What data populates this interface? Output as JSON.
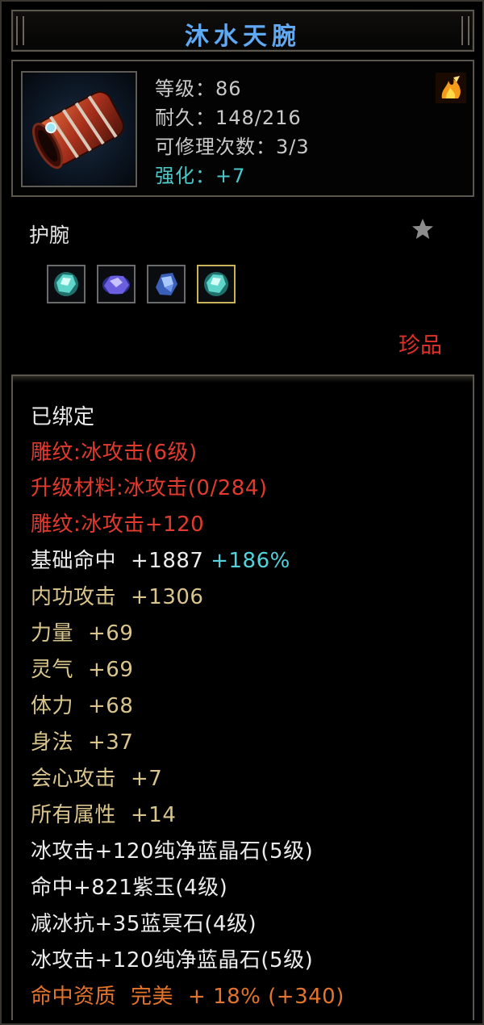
{
  "item": {
    "name": "沐水天腕",
    "level_label": "等级：86",
    "durability_label": "耐久：148/216",
    "repair_label": "可修理次数：3/3",
    "enhance_label": "强化：+7",
    "type": "护腕",
    "rarity": "珍品",
    "icon": "red-bracer-icon"
  },
  "gem_slots": [
    {
      "icon": "teal-gem-icon",
      "selected": false
    },
    {
      "icon": "purple-gem-icon",
      "selected": false
    },
    {
      "icon": "blue-crystal-icon",
      "selected": false
    },
    {
      "icon": "teal-gem-icon",
      "selected": true
    }
  ],
  "properties": {
    "bound": "已绑定",
    "engrave_1": "雕纹:冰攻击(6级)",
    "upgrade_material": "升级材料:冰攻击(0/284)",
    "engrave_2": "雕纹:冰攻击+120",
    "hit_base_name": "基础命中",
    "hit_base_value": "+1887",
    "hit_base_percent": "+186%",
    "internal_attack_name": "内功攻击",
    "internal_attack_value": "+1306",
    "strength_name": "力量",
    "strength_value": "+69",
    "spirit_name": "灵气",
    "spirit_value": "+69",
    "stamina_name": "体力",
    "stamina_value": "+68",
    "agility_name": "身法",
    "agility_value": "+37",
    "crit_name": "会心攻击",
    "crit_value": "+7",
    "all_attr_name": "所有属性",
    "all_attr_value": "+14",
    "gem_line_1": "冰攻击+120纯净蓝晶石(5级)",
    "gem_line_2": "命中+821紫玉(4级)",
    "gem_line_3": "减冰抗+35蓝冥石(4级)",
    "gem_line_4": "冰攻击+120纯净蓝晶石(5级)",
    "quality_name": "命中资质",
    "quality_grade": "完美",
    "quality_value": "+ 18% (+340)"
  },
  "colors": {
    "title": "#5fa8f2",
    "red": "#e23a2e",
    "tan": "#d9c48c",
    "cyan": "#52d2dc",
    "orange": "#e3742b"
  }
}
